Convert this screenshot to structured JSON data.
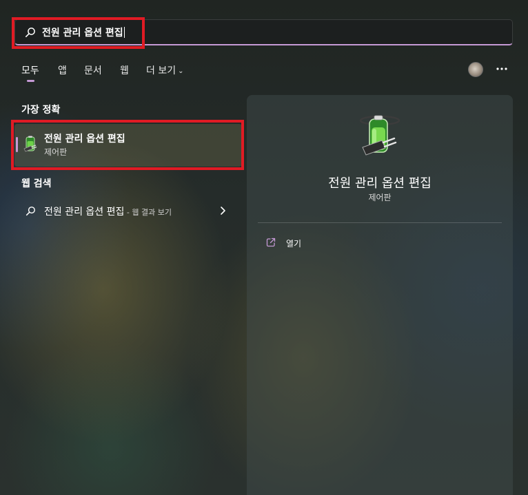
{
  "search": {
    "query": "전원 관리 옵션 편집"
  },
  "tabs": [
    {
      "label": "모두",
      "active": true
    },
    {
      "label": "앱"
    },
    {
      "label": "문서"
    },
    {
      "label": "웹"
    },
    {
      "label": "더 보기"
    }
  ],
  "icons": {
    "search": "search-icon",
    "more_chevron": "chevron-down-icon",
    "account": "avatar",
    "menu": "more-horizontal-icon",
    "battery": "battery-plug-icon",
    "open": "open-external-icon",
    "arrow": "chevron-right-icon"
  },
  "best_match": {
    "section_label": "가장 정확",
    "title": "전원 관리 옵션 편집",
    "subtitle": "제어판"
  },
  "web_search": {
    "section_label": "웹 검색",
    "query": "전원 관리 옵션 편집",
    "suffix": " - 웹 결과 보기"
  },
  "detail": {
    "title": "전원 관리 옵션 편집",
    "subtitle": "제어판",
    "actions": [
      {
        "label": "열기"
      }
    ]
  },
  "colors": {
    "accent": "#c69ad6",
    "highlight_box": "#e01b24"
  }
}
